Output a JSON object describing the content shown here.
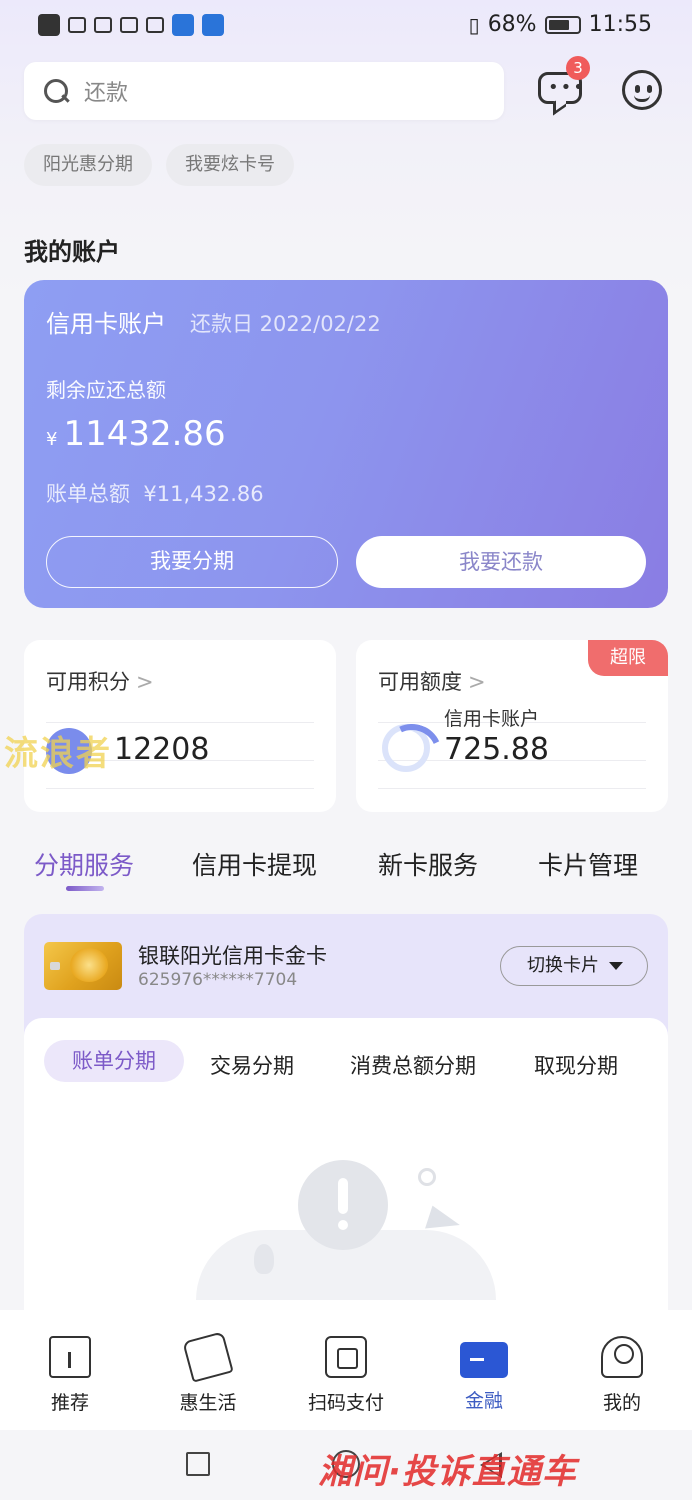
{
  "status_bar": {
    "left_icons": [
      "hd-icon",
      "signal-4g-icon",
      "wifi-icon",
      "missed-call-icon",
      "wechat-icon",
      "app-icon",
      "qq-icon"
    ],
    "battery_percent": "68%",
    "time": "11:55"
  },
  "search": {
    "placeholder": "还款"
  },
  "header": {
    "message_badge": "3"
  },
  "chips": [
    "阳光惠分期",
    "我要炫卡号"
  ],
  "section_title": "我的账户",
  "account": {
    "title": "信用卡账户",
    "due_label": "还款日 2022/02/22",
    "remaining_label": "剩余应还总额",
    "currency": "¥",
    "remaining_amount": "11432.86",
    "bill_label": "账单总额",
    "bill_amount": "¥11,432.86",
    "install_button": "我要分期",
    "repay_button": "我要还款",
    "accent_color": "#8d95ee"
  },
  "points": {
    "label": "可用积分",
    "value": "12208",
    "chevron": ">"
  },
  "limit": {
    "label": "可用额度",
    "sub_label": "信用卡账户",
    "value": "725.88",
    "badge": "超限",
    "chevron": ">"
  },
  "tabs": [
    {
      "label": "分期服务",
      "active": true
    },
    {
      "label": "信用卡提现",
      "active": false
    },
    {
      "label": "新卡服务",
      "active": false
    },
    {
      "label": "卡片管理",
      "active": false
    }
  ],
  "card": {
    "name": "银联阳光信用卡金卡",
    "number": "625976******7704",
    "switch_button": "切换卡片"
  },
  "sub_tabs": [
    {
      "label": "账单分期",
      "active": true
    },
    {
      "label": "交易分期",
      "active": false
    },
    {
      "label": "消费总额分期",
      "active": false
    },
    {
      "label": "取现分期",
      "active": false
    }
  ],
  "bottom_nav": [
    {
      "label": "推荐",
      "icon": "home-icon",
      "active": false
    },
    {
      "label": "惠生活",
      "icon": "tag-icon",
      "active": false
    },
    {
      "label": "扫码支付",
      "icon": "scan-icon",
      "active": false
    },
    {
      "label": "金融",
      "icon": "card-icon",
      "active": true
    },
    {
      "label": "我的",
      "icon": "profile-icon",
      "active": false
    }
  ],
  "watermarks": {
    "left": "流浪者",
    "bottom": "湘问·投诉直通车"
  },
  "colors": {
    "active_tab": "#7c5ac8",
    "nav_active": "#3d5cc2",
    "badge": "#f05b5b"
  }
}
